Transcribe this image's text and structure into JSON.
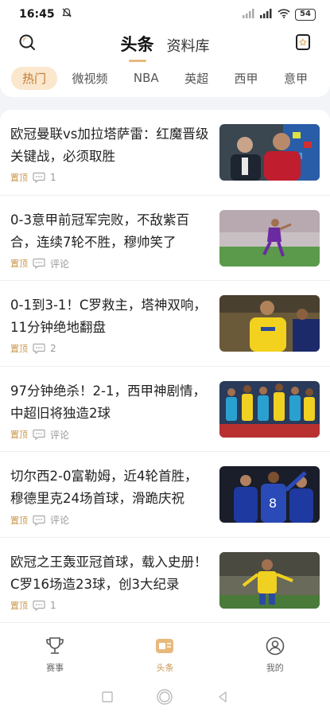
{
  "status": {
    "time": "16:45",
    "battery": "54"
  },
  "header": {
    "tabs": [
      {
        "label": "头条",
        "active": true
      },
      {
        "label": "资料库",
        "active": false
      }
    ],
    "left_icon": "search-icon",
    "right_icon": "bookmark-icon"
  },
  "categories": [
    {
      "label": "热门",
      "active": true
    },
    {
      "label": "微视频",
      "active": false
    },
    {
      "label": "NBA",
      "active": false
    },
    {
      "label": "英超",
      "active": false
    },
    {
      "label": "西甲",
      "active": false
    },
    {
      "label": "意甲",
      "active": false
    }
  ],
  "news": [
    {
      "title": "欧冠曼联vs加拉塔萨雷：红魔晋级关键战，必须取胜",
      "pin": "置顶",
      "comments": "1"
    },
    {
      "title": "0-3意甲前冠军完败，不敌紫百合，连续7轮不胜，穆帅笑了",
      "pin": "置顶",
      "comments": "评论"
    },
    {
      "title": "0-1到3-1！C罗救主，塔神双响，11分钟绝地翻盘",
      "pin": "置顶",
      "comments": "2"
    },
    {
      "title": "97分钟绝杀！2-1，西甲神剧情，中超旧将独造2球",
      "pin": "置顶",
      "comments": "评论"
    },
    {
      "title": "切尔西2-0富勒姆，近4轮首胜，穆德里克24场首球，滑跪庆祝",
      "pin": "置顶",
      "comments": "评论"
    },
    {
      "title": "欧冠之王轰亚冠首球，载入史册！C罗16场造23球，创3大纪录",
      "pin": "置顶",
      "comments": "1"
    }
  ],
  "tabbar": [
    {
      "label": "赛事",
      "icon": "trophy-icon",
      "active": false
    },
    {
      "label": "头条",
      "icon": "news-icon",
      "active": true
    },
    {
      "label": "我的",
      "icon": "profile-icon",
      "active": false
    }
  ],
  "colors": {
    "accent": "#c8964e",
    "active_chip_bg": "#fbe7cd"
  }
}
